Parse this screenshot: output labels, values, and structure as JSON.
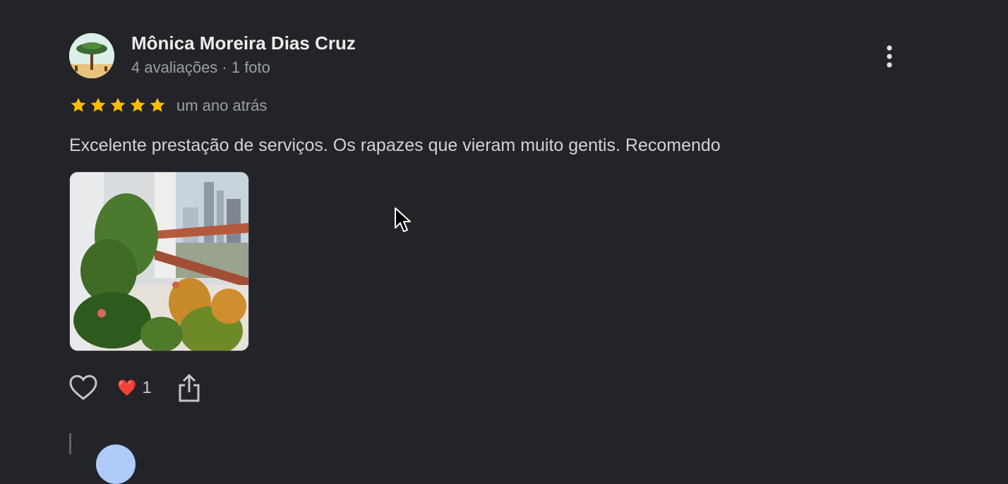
{
  "reviewer": {
    "name": "Mônica Moreira Dias Cruz",
    "meta": "4 avaliações · 1 foto"
  },
  "rating": {
    "stars": 5,
    "max": 5,
    "star_color": "#fbbc04",
    "date": "um ano atrás"
  },
  "review": {
    "text": "Excelente prestação de serviços. Os rapazes que vieram muito gentis. Recomendo"
  },
  "actions": {
    "like_icon": "heart-outline-icon",
    "reaction_emoji": "❤️",
    "reaction_count": "1",
    "share_icon": "share-icon",
    "more_icon": "more-vertical-icon"
  },
  "owner_reply": {
    "text": ""
  }
}
